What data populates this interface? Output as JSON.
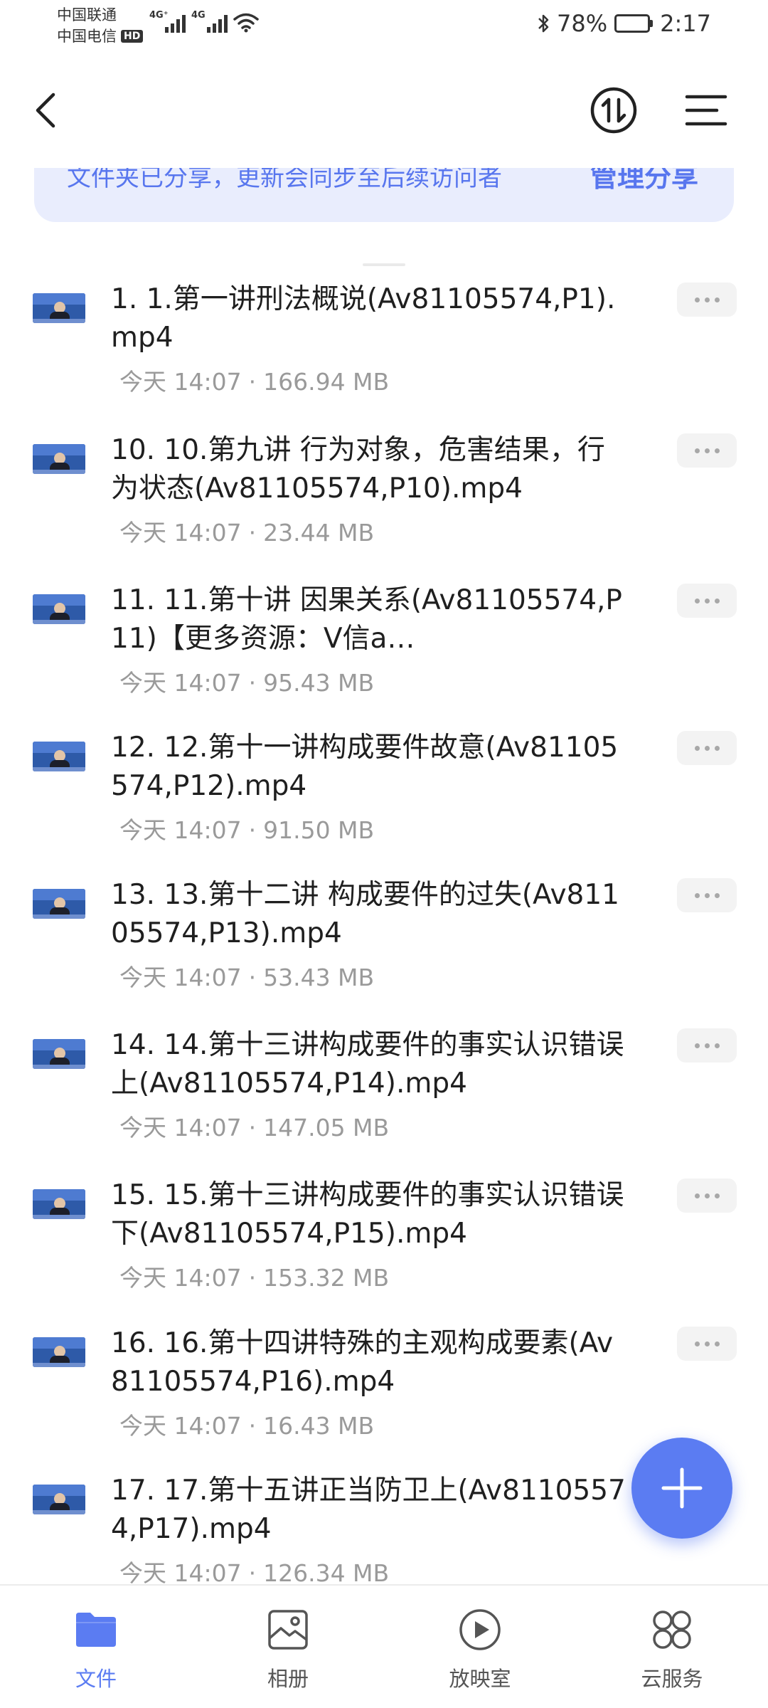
{
  "status_bar": {
    "carrier1": "中国联通",
    "carrier2": "中国电信",
    "hd": "HD",
    "net1": "4G⁺",
    "net2": "4G",
    "battery": "78%",
    "time": "2:17",
    "battery_level": 0.78
  },
  "banner": {
    "text": "文件夹已分享，更新会同步至后续访问者",
    "link": "管理分享"
  },
  "files": [
    {
      "name": "1. 1.第一讲刑法概说(Av81105574,P1).mp4",
      "date": "今天 14:07",
      "size": "166.94 MB"
    },
    {
      "name": "10. 10.第九讲 行为对象，危害结果，行为状态(Av81105574,P10).mp4",
      "date": "今天 14:07",
      "size": "23.44 MB"
    },
    {
      "name": "11. 11.第十讲 因果关系(Av81105574,P11)【更多资源：V信a…",
      "date": "今天 14:07",
      "size": "95.43 MB"
    },
    {
      "name": "12. 12.第十一讲构成要件故意(Av81105574,P12).mp4",
      "date": "今天 14:07",
      "size": "91.50 MB"
    },
    {
      "name": "13. 13.第十二讲 构成要件的过失(Av81105574,P13).mp4",
      "date": "今天 14:07",
      "size": "53.43 MB"
    },
    {
      "name": "14. 14.第十三讲构成要件的事实认识错误上(Av81105574,P14).mp4",
      "date": "今天 14:07",
      "size": "147.05 MB"
    },
    {
      "name": "15. 15.第十三讲构成要件的事实认识错误下(Av81105574,P15).mp4",
      "date": "今天 14:07",
      "size": "153.32 MB"
    },
    {
      "name": "16. 16.第十四讲特殊的主观构成要素(Av81105574,P16).mp4",
      "date": "今天 14:07",
      "size": "16.43 MB"
    },
    {
      "name": "17. 17.第十五讲正当防卫上(Av81105574,P17).mp4",
      "date": "今天 14:07",
      "size": "126.34 MB"
    }
  ],
  "meta_separator": "·",
  "bottom_nav": [
    {
      "label": "文件",
      "icon": "folder-icon",
      "active": true
    },
    {
      "label": "相册",
      "icon": "album-icon",
      "active": false
    },
    {
      "label": "放映室",
      "icon": "play-icon",
      "active": false
    },
    {
      "label": "云服务",
      "icon": "cloud-service-icon",
      "active": false
    }
  ],
  "colors": {
    "accent": "#5b7cf2",
    "banner_bg": "#e9edfd",
    "meta_text": "#9a9a9a"
  }
}
